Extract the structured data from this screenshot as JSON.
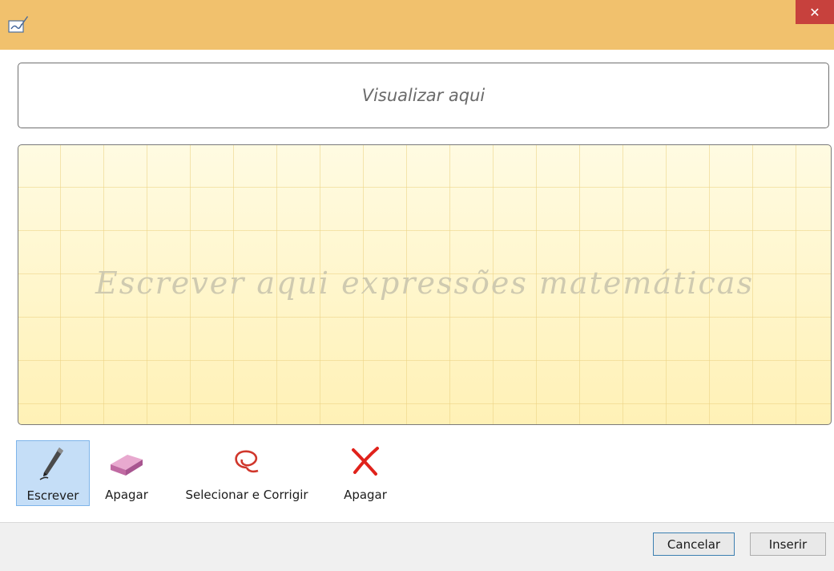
{
  "window": {
    "app_icon": "pen-tablet-icon",
    "close_glyph": "✕",
    "title_color": "#f1c16d",
    "close_color": "#c7413d"
  },
  "preview": {
    "placeholder": "Visualizar aqui"
  },
  "ink_area": {
    "placeholder": "Escrever aqui expressões matemáticas"
  },
  "tools": [
    {
      "label": "Escrever",
      "icon": "pen-icon",
      "selected": true
    },
    {
      "label": "Apagar",
      "icon": "eraser-icon",
      "selected": false
    },
    {
      "label": "Selecionar e Corrigir",
      "icon": "lasso-icon",
      "selected": false
    },
    {
      "label": "Apagar",
      "icon": "clear-x-icon",
      "selected": false
    }
  ],
  "buttons": {
    "cancel": "Cancelar",
    "insert": "Inserir"
  }
}
